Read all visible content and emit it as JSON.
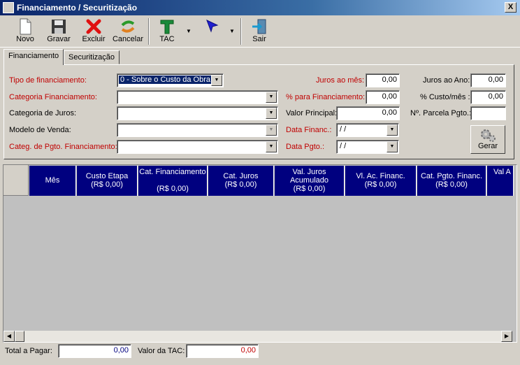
{
  "window": {
    "title": "Financiamento / Securitização",
    "close_glyph": "X"
  },
  "toolbar": {
    "novo": "Novo",
    "gravar": "Gravar",
    "excluir": "Excluir",
    "cancelar": "Cancelar",
    "tac": "TAC",
    "sair": "Sair",
    "dropdown_glyph": "▼"
  },
  "tabs": {
    "financiamento": "Financiamento",
    "securitizacao": "Securitização"
  },
  "form": {
    "tipo_label": "Tipo de financiamento:",
    "tipo_value": "0 - Sobre o Custo da Obra",
    "categoria_label": "Categoria Financiamento:",
    "categoria_juros_label": "Categoria de Juros:",
    "modelo_venda_label": "Modelo de Venda:",
    "categ_pgto_label": "Categ. de Pgto. Financiamento:",
    "juros_mes_label": "Juros ao mês:",
    "juros_mes_value": "0,00",
    "pct_financiamento_label": "%  para Financiamento:",
    "pct_financiamento_value": "0,00",
    "valor_principal_label": "Valor Principal:",
    "valor_principal_value": "0,00",
    "data_financ_label": "Data Financ.:",
    "data_financ_value": " / /",
    "data_pgto_label": "Data Pgto.:",
    "data_pgto_value": " / /",
    "juros_ano_label": "Juros ao Ano:",
    "juros_ano_value": "0,00",
    "pct_custo_mes_label": "% Custo/mês :",
    "pct_custo_mes_value": "0,00",
    "num_parcela_label": "Nº. Parcela Pgto.:",
    "num_parcela_value": "",
    "gerar_label": "Gerar",
    "arrow_glyph": "▼"
  },
  "grid": {
    "columns": [
      {
        "l1": "Mês",
        "l2": "",
        "l3": ""
      },
      {
        "l1": "Custo Etapa",
        "l2": "(R$ 0,00)",
        "l3": ""
      },
      {
        "l1": "Cat. Financiamento",
        "l2": "",
        "l3": "(R$ 0,00)"
      },
      {
        "l1": "Cat. Juros",
        "l2": "(R$ 0,00)",
        "l3": ""
      },
      {
        "l1": "Val. Juros",
        "l2": "Acumulado",
        "l3": "(R$ 0,00)"
      },
      {
        "l1": "Vl. Ac. Financ.",
        "l2": "(R$ 0,00)",
        "l3": ""
      },
      {
        "l1": "Cat. Pgto. Financ.",
        "l2": "(R$ 0,00)",
        "l3": ""
      },
      {
        "l1": "Val A",
        "l2": "",
        "l3": ""
      }
    ],
    "scroll_left": "◀",
    "scroll_right": "▶"
  },
  "footer": {
    "total_label": "Total a Pagar:",
    "total_value": "0,00",
    "tac_label": "Valor da TAC:",
    "tac_value": "0,00"
  },
  "colors": {
    "accent": "#0a246a",
    "grid_header": "#00007f",
    "label_red": "#c00000",
    "tac_value": "#c00000"
  }
}
